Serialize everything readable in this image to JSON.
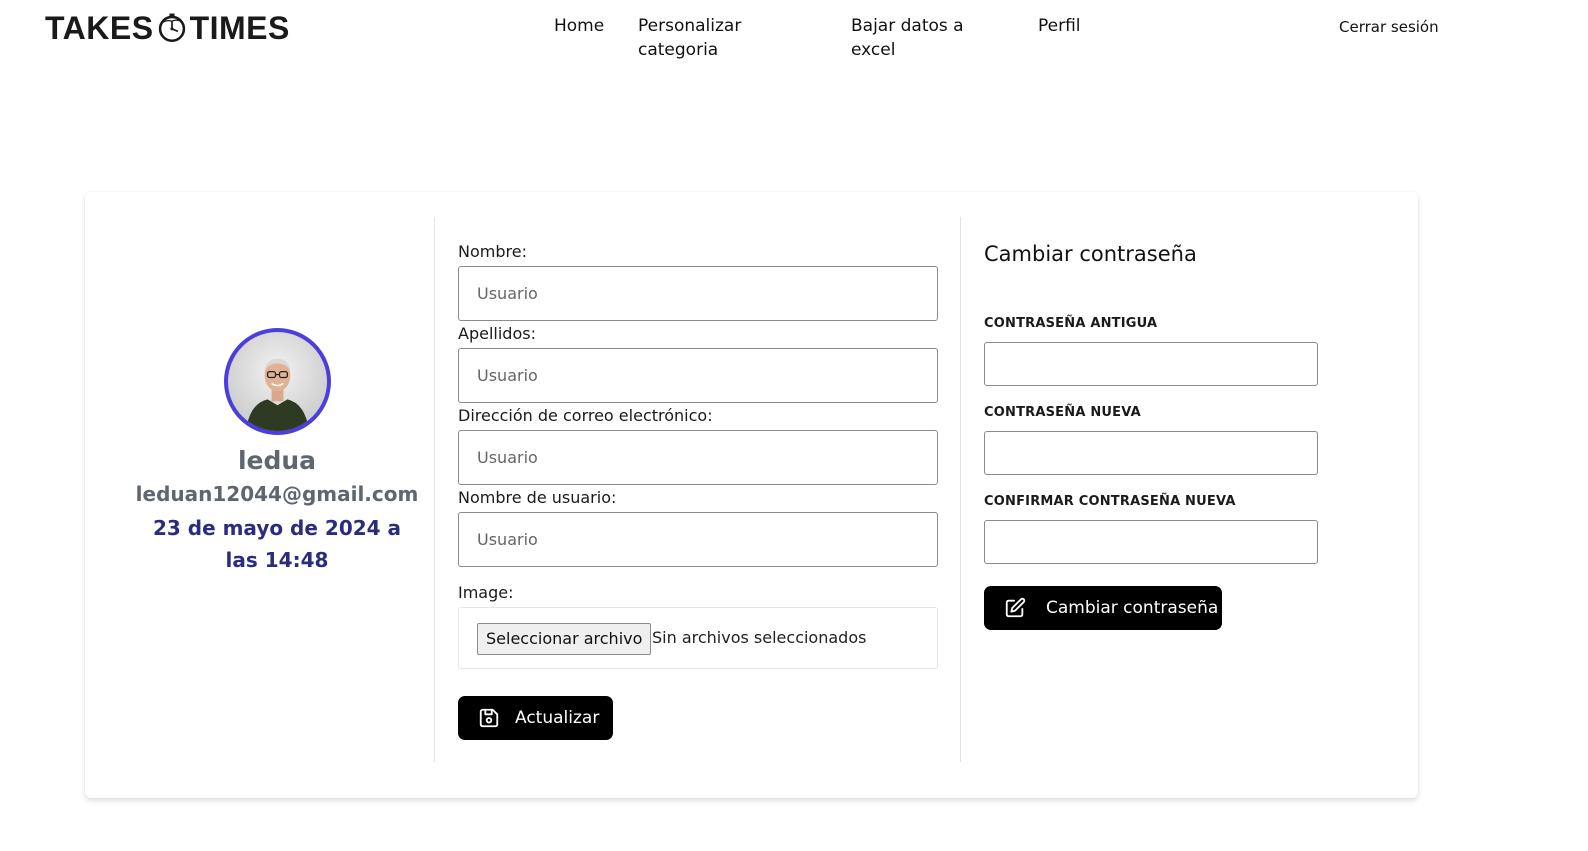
{
  "navbar": {
    "logo_left": "TAKES",
    "logo_right": "TIMES",
    "links": [
      "Home",
      "Personalizar categoria",
      "Bajar datos a excel",
      "Perfil"
    ],
    "logout": "Cerrar sesión"
  },
  "profile": {
    "username": "ledua",
    "email": "leduan12044@gmail.com",
    "date_line1": "23 de mayo de 2024 a",
    "date_line2": "las 14:48",
    "avatar_border_color": "#4a3fdc"
  },
  "form": {
    "fields": [
      {
        "label": "Nombre:",
        "placeholder": "Usuario",
        "value": ""
      },
      {
        "label": "Apellidos:",
        "placeholder": "Usuario",
        "value": ""
      },
      {
        "label": "Dirección de correo electrónico:",
        "placeholder": "Usuario",
        "value": ""
      },
      {
        "label": "Nombre de usuario:",
        "placeholder": "Usuario",
        "value": ""
      }
    ],
    "image_label": "Image:",
    "file_button": "Seleccionar archivo",
    "file_status": "Sin archivos seleccionados",
    "submit_label": "Actualizar",
    "submit_icon": "save-icon"
  },
  "password": {
    "title": "Cambiar contraseña",
    "old_label": "CONTRASEÑA ANTIGUA",
    "new_label": "CONTRASEÑA NUEVA",
    "confirm_label": "CONFIRMAR CONTRASEÑA NUEVA",
    "submit_label": "Cambiar contraseña",
    "submit_icon": "edit-icon"
  }
}
